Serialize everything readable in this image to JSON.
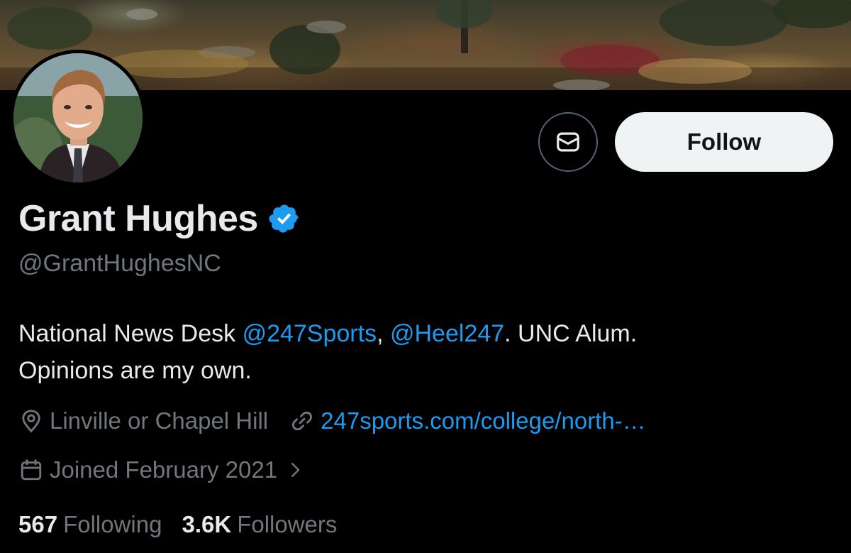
{
  "profile": {
    "name": "Grant Hughes",
    "handle": "@GrantHughesNC",
    "verified_icon": "verified-badge-icon",
    "bio": {
      "text_1": "National News Desk ",
      "mention_1": "@247Sports",
      "sep": ", ",
      "mention_2": "@Heel247",
      "text_2": ". UNC Alum.",
      "line_2": "Opinions are my own."
    },
    "location": "Linville or Chapel Hill",
    "website": "247sports.com/college/north-…",
    "joined": "Joined February 2021"
  },
  "actions": {
    "follow_label": "Follow",
    "message_icon": "envelope-icon"
  },
  "stats": {
    "following_count": "567",
    "following_label": "Following",
    "followers_count": "3.6K",
    "followers_label": "Followers"
  },
  "colors": {
    "background": "#000000",
    "text": "#e7e9ea",
    "muted": "#71767b",
    "link": "#1d9bf0",
    "follow_bg": "#eff3f4"
  }
}
